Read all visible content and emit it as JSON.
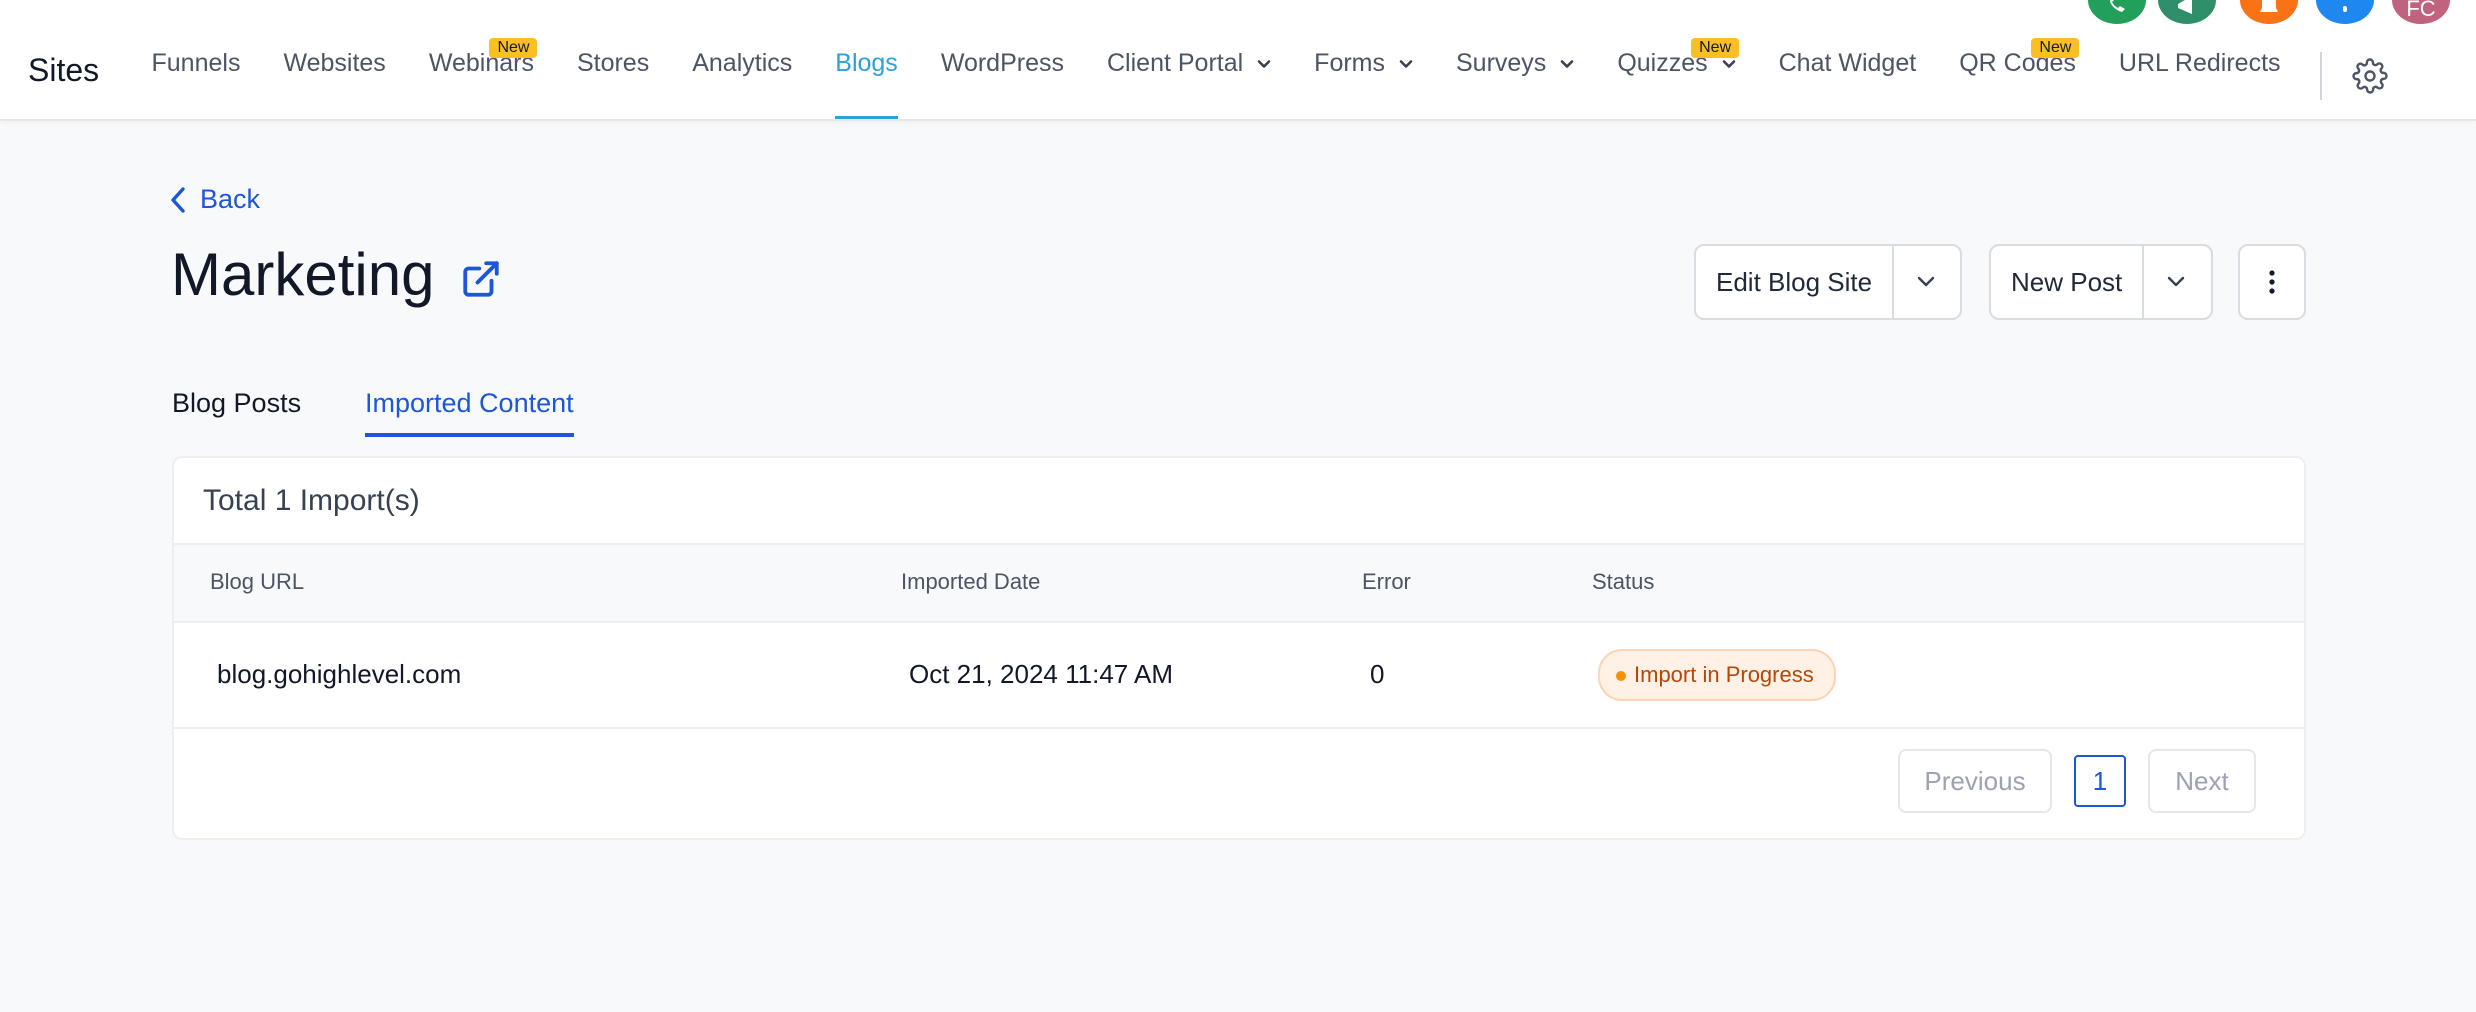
{
  "app": {
    "brand": "Sites"
  },
  "nav": {
    "items": [
      {
        "label": "Funnels"
      },
      {
        "label": "Websites"
      },
      {
        "label": "Webinars",
        "badge": "New"
      },
      {
        "label": "Stores"
      },
      {
        "label": "Analytics"
      },
      {
        "label": "Blogs",
        "active": true
      },
      {
        "label": "WordPress"
      },
      {
        "label": "Client Portal",
        "dropdown": true
      },
      {
        "label": "Forms",
        "dropdown": true
      },
      {
        "label": "Surveys",
        "dropdown": true
      },
      {
        "label": "Quizzes",
        "dropdown": true,
        "badge": "New"
      },
      {
        "label": "Chat Widget"
      },
      {
        "label": "QR Codes",
        "badge": "New"
      },
      {
        "label": "URL Redirects"
      }
    ],
    "icons": [
      "gear-icon"
    ],
    "accent_color": "#2fa0d6",
    "top_action_colors": [
      "#22a05a",
      "#2f8f6b",
      "#f97316",
      "#1e88f0",
      "#c0637e"
    ],
    "avatar_initials": "FC"
  },
  "page": {
    "back_label": "Back",
    "title": "Marketing",
    "edit_blog_site_label": "Edit Blog Site",
    "new_post_label": "New Post",
    "primary_color": "#1d56d8"
  },
  "tabs": {
    "blog_posts": "Blog Posts",
    "imported_content": "Imported Content"
  },
  "imports": {
    "total_label": "Total 1 Import(s)",
    "columns": [
      "Blog URL",
      "Imported Date",
      "Error",
      "Status"
    ],
    "rows": [
      {
        "blog_url": "blog.gohighlevel.com",
        "imported_date": "Oct 21, 2024 11:47 AM",
        "error": "0",
        "status": "Import in Progress"
      }
    ],
    "pagination": {
      "previous": "Previous",
      "current_page": "1",
      "next": "Next"
    }
  }
}
